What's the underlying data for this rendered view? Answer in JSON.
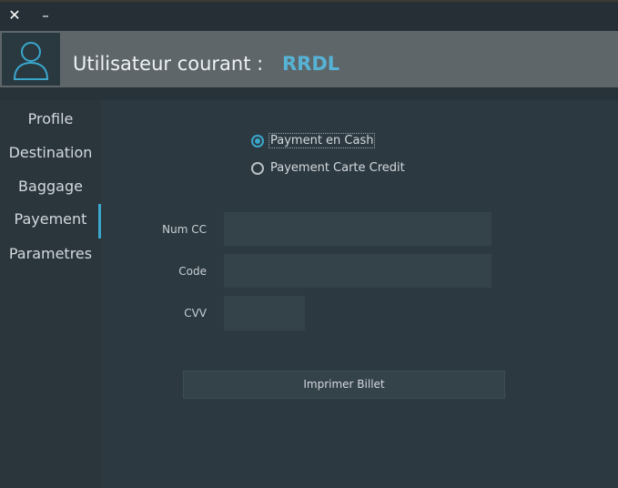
{
  "window": {
    "close_glyph": "✕",
    "minimize_glyph": "–"
  },
  "header": {
    "title": "Utilisateur courant :",
    "username": "RRDL",
    "avatar_icon": "user-icon"
  },
  "sidebar": {
    "items": [
      {
        "label": "Profile",
        "active": false
      },
      {
        "label": "Destination",
        "active": false
      },
      {
        "label": "Baggage",
        "active": false
      },
      {
        "label": "Payement",
        "active": true
      },
      {
        "label": "Parametres",
        "active": false
      }
    ]
  },
  "payment": {
    "options": [
      {
        "label": "Payment en Cash",
        "selected": true
      },
      {
        "label": "Payement Carte Credit",
        "selected": false
      }
    ]
  },
  "form": {
    "num_cc_label": "Num CC",
    "num_cc_value": "",
    "code_label": "Code",
    "code_value": "",
    "cvv_label": "CVV",
    "cvv_value": "",
    "print_button": "Imprimer Billet"
  },
  "colors": {
    "accent": "#3aa7cc",
    "username": "#56b3d6",
    "background": "#2d3a41",
    "header": "#5f6669"
  }
}
